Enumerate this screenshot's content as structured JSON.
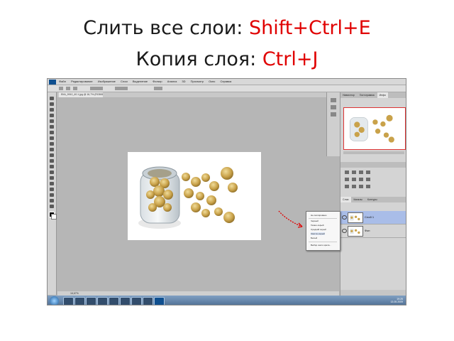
{
  "title": {
    "line1_text": "Слить все слои: ",
    "line1_hotkey": "Shift+Ctrl+E",
    "line2_text": "Копия слоя: ",
    "line2_hotkey": "Ctrl+J",
    "hotkey_color": "#e00000"
  },
  "colors": {
    "workspace": "#b4b4b4",
    "selected_layer": "#a9bde8",
    "annotation_arrow": "#e00000"
  },
  "photoshop": {
    "app_icon": "Ps",
    "menu": [
      "Файл",
      "Редактирование",
      "Изображение",
      "Слои",
      "Выделение",
      "Фильтр",
      "Анализ",
      "3D",
      "Просмотр",
      "Окно",
      "Справка"
    ],
    "document_tab": "ЕКА_9910_40.1.jpg @ 16,7% (RGB/8)",
    "status_text": "16,67%",
    "panel_tabs": [
      "Навигатор",
      "Гистограмма",
      "Инфо"
    ],
    "layers_tabs": [
      "Слои",
      "Каналы",
      "Контуры"
    ],
    "layers": [
      {
        "name": "Слой 1"
      },
      {
        "name": "Фон"
      }
    ],
    "context_menu": [
      "Не скопировано",
      "Черный",
      "Темно-серый",
      "Средний серый",
      "Светло-серый",
      "Белый",
      "Выбор иного цвета..."
    ],
    "taskbar": {
      "time": "19:25",
      "date": "13.05.2009"
    }
  }
}
